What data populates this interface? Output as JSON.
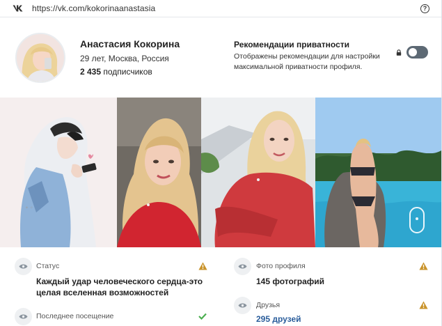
{
  "browser": {
    "url": "https://vk.com/kokorinaanastasia",
    "logo_icon": "vk-logo-icon",
    "help_icon": "?"
  },
  "profile": {
    "name": "Анастасия Кокорина",
    "meta": "29 лет, Москва, Россия",
    "followers_count": "2 435",
    "followers_label": "подписчиков"
  },
  "privacy": {
    "title": "Рекомендации приватности",
    "description": "Отображены рекомендации для настройки максимальной приватности профиля.",
    "toggle_on": false
  },
  "photos": [
    {
      "name": "photo-illustration"
    },
    {
      "name": "photo-selfie-red"
    },
    {
      "name": "photo-selfie-sweater"
    },
    {
      "name": "photo-pool"
    }
  ],
  "info": {
    "status": {
      "label": "Статус",
      "value": "Каждый удар человеческого сердца-это целая вселенная возможностей",
      "state_icon": "warning-icon"
    },
    "last_seen": {
      "label": "Последнее посещение",
      "state_icon": "check-icon"
    },
    "profile_photo": {
      "label": "Фото профиля",
      "value": "145 фотографий",
      "state_icon": "warning-icon"
    },
    "friends": {
      "label": "Друзья",
      "value": "295 друзей",
      "state_icon": "warning-icon"
    }
  },
  "colors": {
    "accent_link": "#2a5d9b",
    "warning": "#c9932a",
    "ok": "#4caf50",
    "toggle": "#5d6974"
  }
}
